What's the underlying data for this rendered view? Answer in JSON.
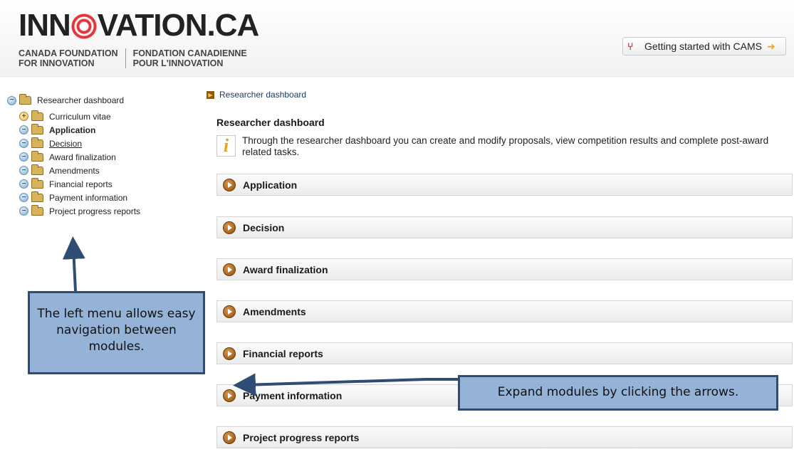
{
  "header": {
    "logo_main_prefix": "INN",
    "logo_main_suffix": "VATION.CA",
    "logo_en_line1": "CANADA FOUNDATION",
    "logo_en_line2": "FOR INNOVATION",
    "logo_fr_line1": "FONDATION CANADIENNE",
    "logo_fr_line2": "POUR L'INNOVATION",
    "getting_started_label": "Getting started with CAMS"
  },
  "sidebar": {
    "root_label": "Researcher dashboard",
    "items": [
      {
        "label": "Curriculum vitae"
      },
      {
        "label": "Application"
      },
      {
        "label": "Decision"
      },
      {
        "label": "Award finalization"
      },
      {
        "label": "Amendments"
      },
      {
        "label": "Financial reports"
      },
      {
        "label": "Payment information"
      },
      {
        "label": "Project progress reports"
      }
    ]
  },
  "breadcrumb": {
    "label": "Researcher dashboard"
  },
  "main": {
    "title": "Researcher dashboard",
    "info_text": "Through the researcher dashboard you can create and modify proposals, view competition results and complete post-award related tasks.",
    "modules": [
      {
        "label": "Application"
      },
      {
        "label": "Decision"
      },
      {
        "label": "Award finalization"
      },
      {
        "label": "Amendments"
      },
      {
        "label": "Financial reports"
      },
      {
        "label": "Payment information"
      },
      {
        "label": "Project progress reports"
      }
    ]
  },
  "callouts": {
    "left": "The left menu allows easy navigation between modules.",
    "right": "Expand modules by clicking the arrows."
  },
  "colors": {
    "callout_fill": "#95b3d7",
    "callout_border": "#2f4c72",
    "logo_accent": "#e3353b"
  }
}
